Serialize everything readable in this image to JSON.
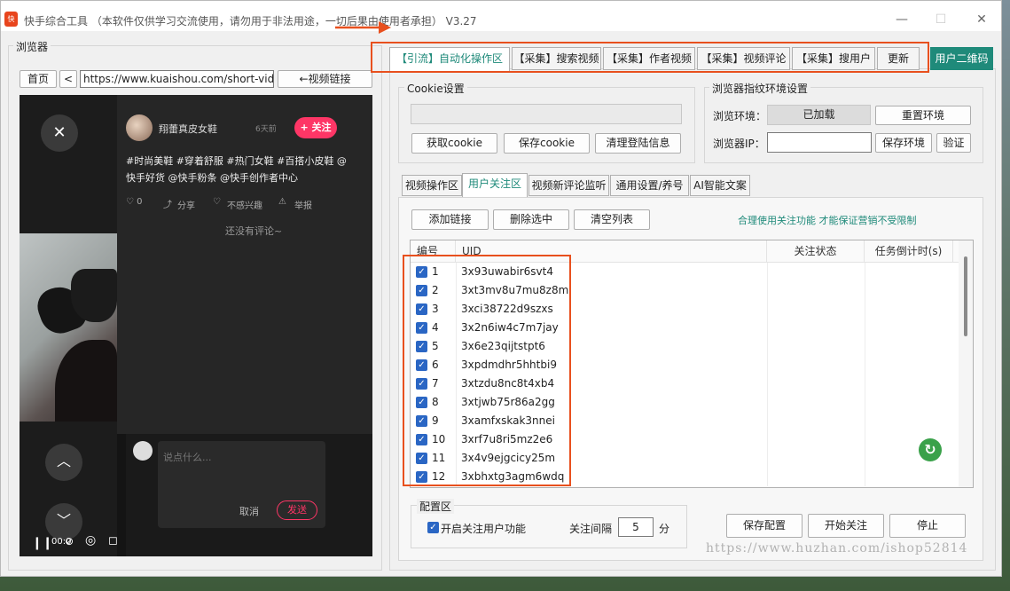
{
  "window": {
    "title": "快手综合工具 （本软件仅供学习交流使用，请勿用于非法用途，一切后果由使用者承担） V3.27",
    "icon_text": "快"
  },
  "browser_panel": {
    "group_label": "浏览器",
    "home": "首页",
    "back": "<",
    "url": "https://www.kuaishou.com/short-video",
    "video_link": "←视频链接",
    "author": "翔蕾真皮女鞋",
    "time_ago": "6天前",
    "follow": "+ 关注",
    "caption": "#时尚美鞋 #穿着舒服 #热门女鞋 #百搭小皮鞋 @快手好货 @快手粉条 @快手创作者中心",
    "likes": "♡ 0",
    "share": "分享",
    "dislike": "不感兴趣",
    "report": "举报",
    "no_comments": "还没有评论~",
    "comment_placeholder": "说点什么...",
    "cancel": "取消",
    "send": "发送",
    "time": "00:0"
  },
  "tabs": [
    "【引流】自动化操作区",
    "【采集】搜索视频",
    "【采集】作者视频",
    "【采集】视频评论",
    "【采集】搜用户",
    "更新",
    "用户二维码"
  ],
  "cookie": {
    "label": "Cookie设置",
    "get": "获取cookie",
    "save": "保存cookie",
    "clear": "清理登陆信息"
  },
  "fingerprint": {
    "label": "浏览器指纹环境设置",
    "env_label": "浏览环境：",
    "env_value": "已加载",
    "reset": "重置环境",
    "ip_label": "浏览器IP：",
    "save": "保存环境",
    "verify": "验证"
  },
  "subtabs": [
    "视频操作区",
    "用户关注区",
    "视频新评论监听",
    "通用设置/养号",
    "AI智能文案"
  ],
  "follow_area": {
    "add_link": "添加链接",
    "delete_selected": "删除选中",
    "clear_list": "清空列表",
    "notice": "合理使用关注功能 才能保证营销不受限制",
    "columns": [
      "编号",
      "UID",
      "关注状态",
      "任务倒计时(s)"
    ],
    "rows": [
      {
        "n": "1",
        "uid": "3x93uwabir6svt4"
      },
      {
        "n": "2",
        "uid": "3xt3mv8u7mu8z8m"
      },
      {
        "n": "3",
        "uid": "3xci38722d9szxs"
      },
      {
        "n": "4",
        "uid": "3x2n6iw4c7m7jay"
      },
      {
        "n": "5",
        "uid": "3x6e23qijtstpt6"
      },
      {
        "n": "6",
        "uid": "3xpdmdhr5hhtbi9"
      },
      {
        "n": "7",
        "uid": "3xtzdu8nc8t4xb4"
      },
      {
        "n": "8",
        "uid": "3xtjwb75r86a2gg"
      },
      {
        "n": "9",
        "uid": "3xamfxskak3nnei"
      },
      {
        "n": "10",
        "uid": "3xrf7u8ri5mz2e6"
      },
      {
        "n": "11",
        "uid": "3x4v9ejgcicy25m"
      },
      {
        "n": "12",
        "uid": "3xbhxtg3agm6wdq"
      }
    ]
  },
  "config": {
    "label": "配置区",
    "enable": "开启关注用户功能",
    "interval_label": "关注间隔",
    "interval_value": "5",
    "unit": "分",
    "save": "保存配置",
    "start": "开始关注",
    "stop": "停止"
  },
  "watermark": "https://www.huzhan.com/ishop52814",
  "colors": {
    "accent_teal": "#1f8a7a",
    "highlight": "#e8501e",
    "follow_pink": "#fe3666",
    "refresh_green": "#3aa14a"
  }
}
